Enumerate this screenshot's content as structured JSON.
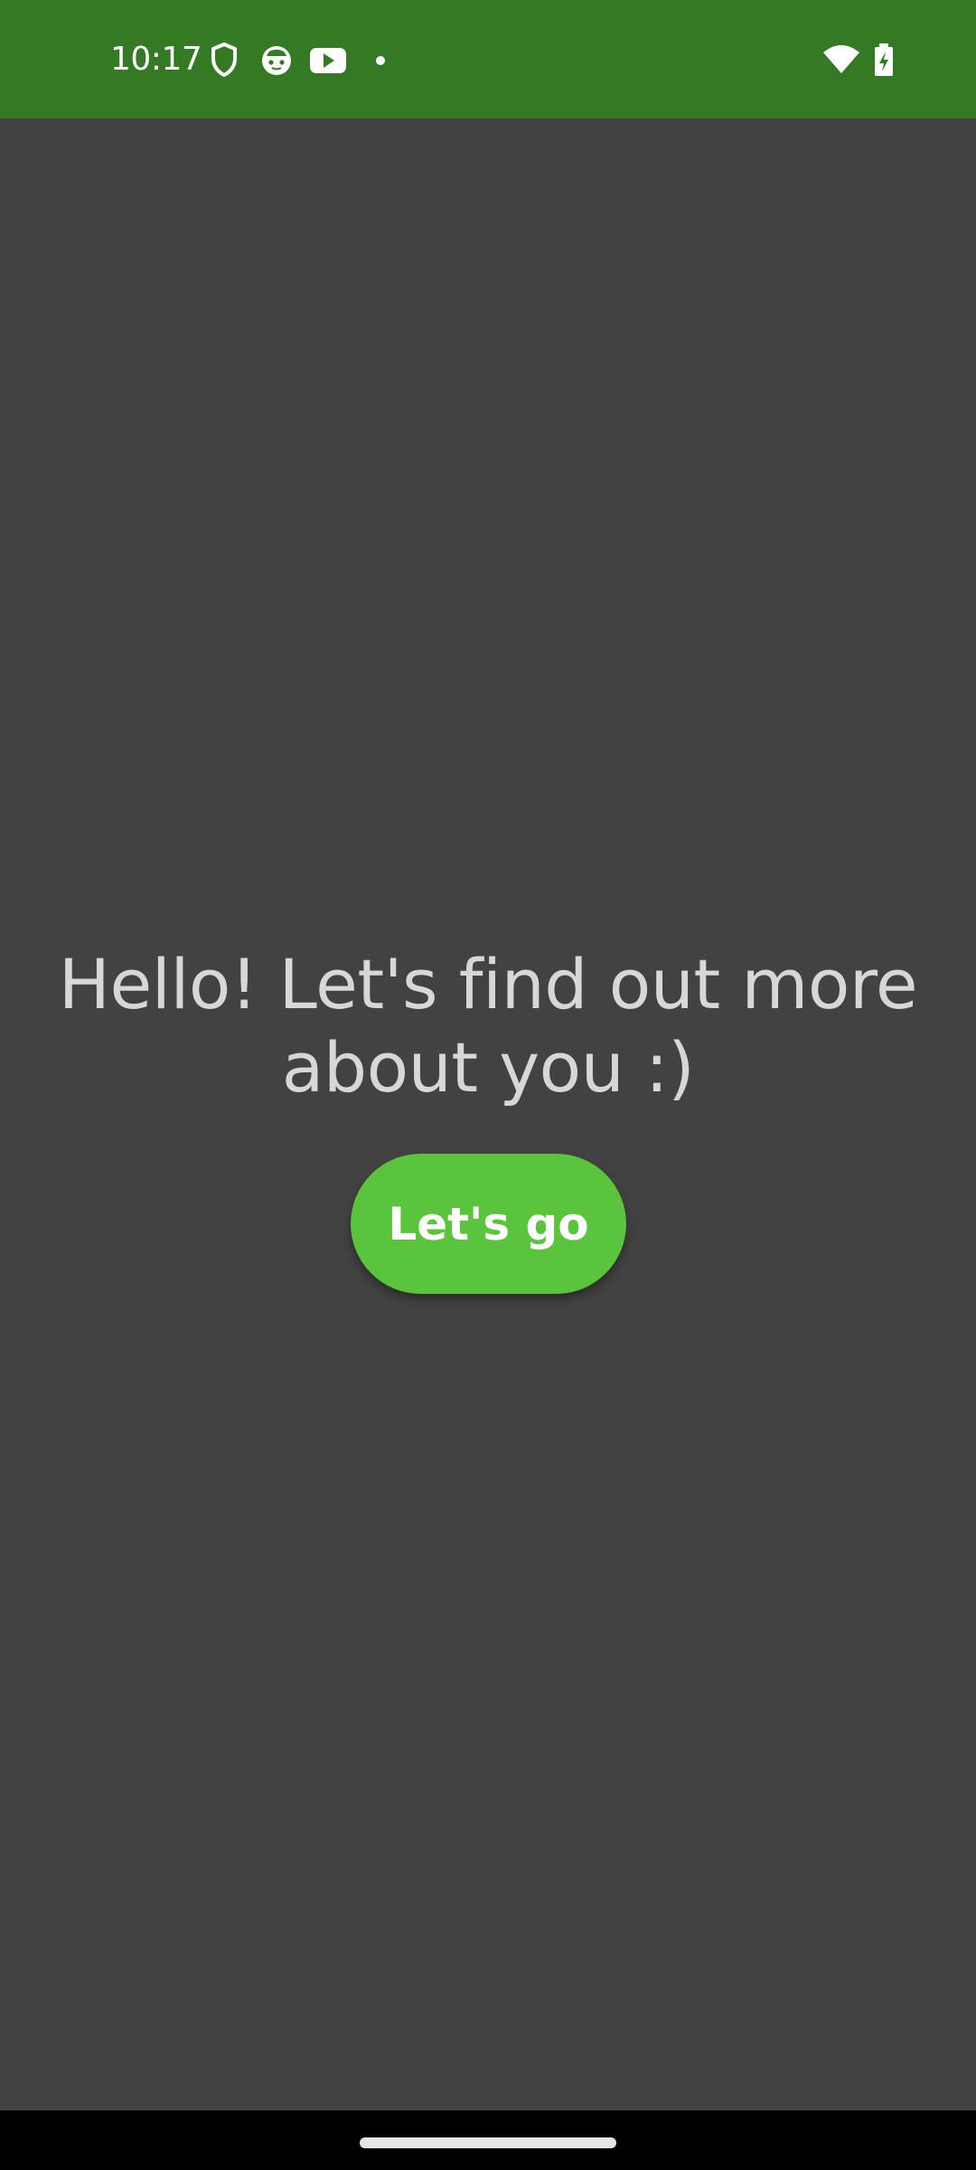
{
  "status_bar": {
    "time": "10:17",
    "background": "#347a24",
    "icons": [
      "shield-icon",
      "cat-face-icon",
      "youtube-icon",
      "notification-dot-icon",
      "wifi-icon",
      "battery-charging-icon"
    ]
  },
  "main": {
    "background": "#424242",
    "headline": "Hello! Let's find out more about you :)",
    "cta_label": "Let's go",
    "cta_color": "#5bc43d"
  },
  "nav_bar": {
    "background": "#000000",
    "gesture": "home-handle"
  }
}
